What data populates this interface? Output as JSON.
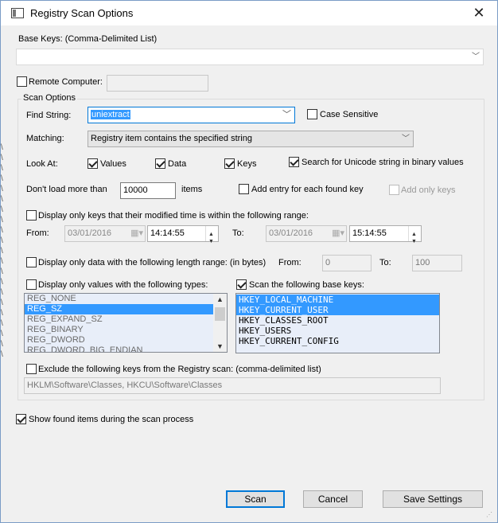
{
  "title": "Registry Scan Options",
  "base_keys": {
    "label": "Base Keys:  (Comma-Delimited List)",
    "value": ""
  },
  "remote_computer": {
    "label": "Remote Computer:",
    "checked": false,
    "value": ""
  },
  "scan_options_label": "Scan Options",
  "find_string": {
    "label": "Find String:",
    "value": "uniextract"
  },
  "case_sensitive": {
    "label": "Case Sensitive",
    "checked": false
  },
  "matching": {
    "label": "Matching:",
    "value": "Registry item contains the specified string"
  },
  "look_at": {
    "label": "Look At:",
    "values": {
      "label": "Values",
      "checked": true
    },
    "data": {
      "label": "Data",
      "checked": true
    },
    "keys": {
      "label": "Keys",
      "checked": true
    },
    "unicode": {
      "label": "Search for Unicode string in binary values",
      "checked": true
    }
  },
  "dont_load": {
    "label": "Don't load more than",
    "value": "10000",
    "suffix": "items"
  },
  "add_entry": {
    "label": "Add entry for each found key",
    "checked": false
  },
  "add_only_keys": {
    "label": "Add only keys",
    "checked": false,
    "disabled": true
  },
  "modified_range": {
    "label": "Display only keys that their modified time is within the following range:",
    "checked": false,
    "from_label": "From:",
    "from_date": "03/01/2016",
    "from_time": "14:14:55",
    "to_label": "To:",
    "to_date": "03/01/2016",
    "to_time": "15:14:55"
  },
  "length_range": {
    "label": "Display only data with the following length range: (in bytes)",
    "checked": false,
    "from_label": "From:",
    "from_value": "0",
    "to_label": "To:",
    "to_value": "100"
  },
  "value_types": {
    "label": "Display only values with the following types:",
    "checked": false,
    "items": [
      "REG_NONE",
      "REG_SZ",
      "REG_EXPAND_SZ",
      "REG_BINARY",
      "REG_DWORD",
      "REG_DWORD_BIG_ENDIAN"
    ],
    "selected_index": 1
  },
  "base_keys_scan": {
    "label": "Scan the following base keys:",
    "checked": true,
    "items": [
      "HKEY_LOCAL_MACHINE",
      "HKEY_CURRENT_USER",
      "HKEY_CLASSES_ROOT",
      "HKEY_USERS",
      "HKEY_CURRENT_CONFIG"
    ],
    "selected": [
      0,
      1
    ]
  },
  "exclude": {
    "label": "Exclude the following keys from the Registry scan: (comma-delimited list)",
    "checked": false,
    "value": "HKLM\\Software\\Classes, HKCU\\Software\\Classes"
  },
  "show_found": {
    "label": "Show found items during the scan process",
    "checked": true
  },
  "buttons": {
    "scan": "Scan",
    "cancel": "Cancel",
    "save": "Save Settings"
  },
  "icons": {
    "close": "close-icon",
    "app": "app-window-icon",
    "dropdown": "chevron-down-icon"
  }
}
